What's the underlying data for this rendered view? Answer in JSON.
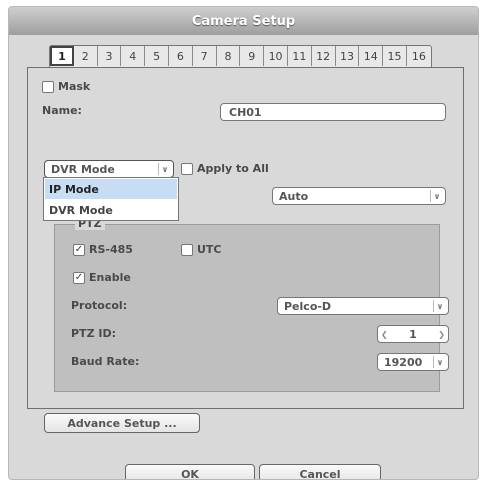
{
  "window": {
    "title": "Camera Setup"
  },
  "channel_tabs": [
    "1",
    "2",
    "3",
    "4",
    "5",
    "6",
    "7",
    "8",
    "9",
    "10",
    "11",
    "12",
    "13",
    "14",
    "15",
    "16"
  ],
  "active_tab": 0,
  "mask": {
    "label": "Mask",
    "checked": false
  },
  "name": {
    "label": "Name:",
    "value": "CH01"
  },
  "mode": {
    "selected": "DVR Mode",
    "options": [
      "IP Mode",
      "DVR Mode"
    ],
    "highlighted": "IP Mode"
  },
  "apply_to_all": {
    "label": "Apply to All",
    "checked": false
  },
  "auto_select": {
    "value": "Auto"
  },
  "ptz": {
    "legend": "PTZ",
    "rs485": {
      "label": "RS-485",
      "checked": true
    },
    "utc": {
      "label": "UTC",
      "checked": false
    },
    "enable": {
      "label": "Enable",
      "checked": true
    },
    "protocol": {
      "label": "Protocol:",
      "value": "Pelco-D"
    },
    "ptz_id": {
      "label": "PTZ ID:",
      "value": "1"
    },
    "baud_rate": {
      "label": "Baud Rate:",
      "value": "19200"
    }
  },
  "buttons": {
    "advance": "Advance Setup ...",
    "ok": "OK",
    "cancel": "Cancel"
  },
  "glyphs": {
    "check": "✓",
    "chevron_down": "∨",
    "left": "❮",
    "right": "❯"
  }
}
